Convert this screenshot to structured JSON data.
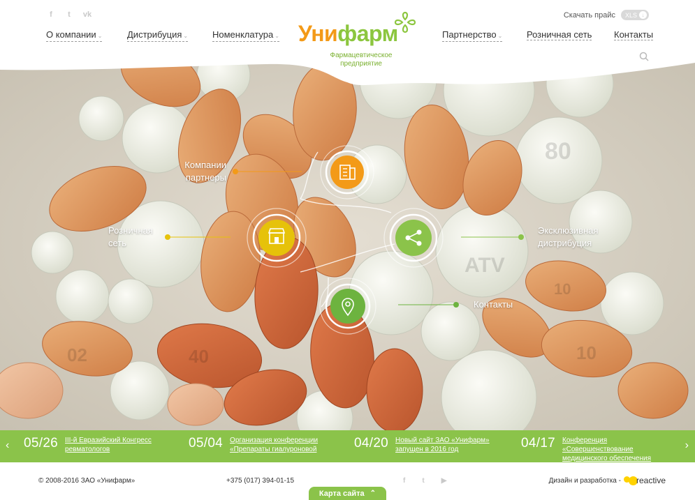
{
  "header": {
    "social": [
      {
        "icon": "facebook-icon",
        "glyph": "f"
      },
      {
        "icon": "twitter-icon",
        "glyph": "t"
      },
      {
        "icon": "vk-icon",
        "glyph": "vk"
      }
    ],
    "price_label": "Скачать прайс",
    "price_badge": "XLS",
    "nav_left": [
      {
        "label": "О компании",
        "has_caret": true
      },
      {
        "label": "Дистрибуция",
        "has_caret": true
      },
      {
        "label": "Номенклатура",
        "has_caret": true
      }
    ],
    "nav_right": [
      {
        "label": "Партнерство",
        "has_caret": true
      },
      {
        "label": "Розничная сеть",
        "has_caret": false
      },
      {
        "label": "Контакты",
        "has_caret": false
      }
    ],
    "logo_part1": "Уни",
    "logo_part2": "фарм",
    "logo_tagline": "Фармацевтическое предприятие"
  },
  "hero": {
    "hubs": [
      {
        "label": "Компании партнеры",
        "icon": "building-icon",
        "color": "#f39a18"
      },
      {
        "label": "Розничная сеть",
        "icon": "store-icon",
        "color": "#e6c20a"
      },
      {
        "label": "Эксклюзивная дистрибуция",
        "icon": "share-icon",
        "color": "#8bc34a"
      },
      {
        "label": "Контакты",
        "icon": "map-pin-icon",
        "color": "#6db33f"
      }
    ]
  },
  "news": [
    {
      "date": "05/26",
      "text": "III-й Евразийский Конгресс ревматологов"
    },
    {
      "date": "05/04",
      "text": "Организация конференции «Препараты гиалуроновой"
    },
    {
      "date": "04/20",
      "text": "Новый сайт ЗАО «Унифарм» запущен в 2016 год"
    },
    {
      "date": "04/17",
      "text": "Конференция «Совершенствование медицинского обеспечения"
    }
  ],
  "footer": {
    "copyright": "© 2008-2016 ЗАО «Унифарм»",
    "phone": "+375 (017) 394-01-15",
    "social": [
      {
        "icon": "facebook-icon",
        "glyph": "f"
      },
      {
        "icon": "twitter-icon",
        "glyph": "t"
      },
      {
        "icon": "youtube-icon",
        "glyph": "▶"
      }
    ],
    "design_label": "Дизайн и разработка -",
    "design_brand": "reactive",
    "sitemap_label": "Карта сайта"
  },
  "colors": {
    "accent_green": "#8bc34a",
    "accent_orange": "#f39a18"
  }
}
